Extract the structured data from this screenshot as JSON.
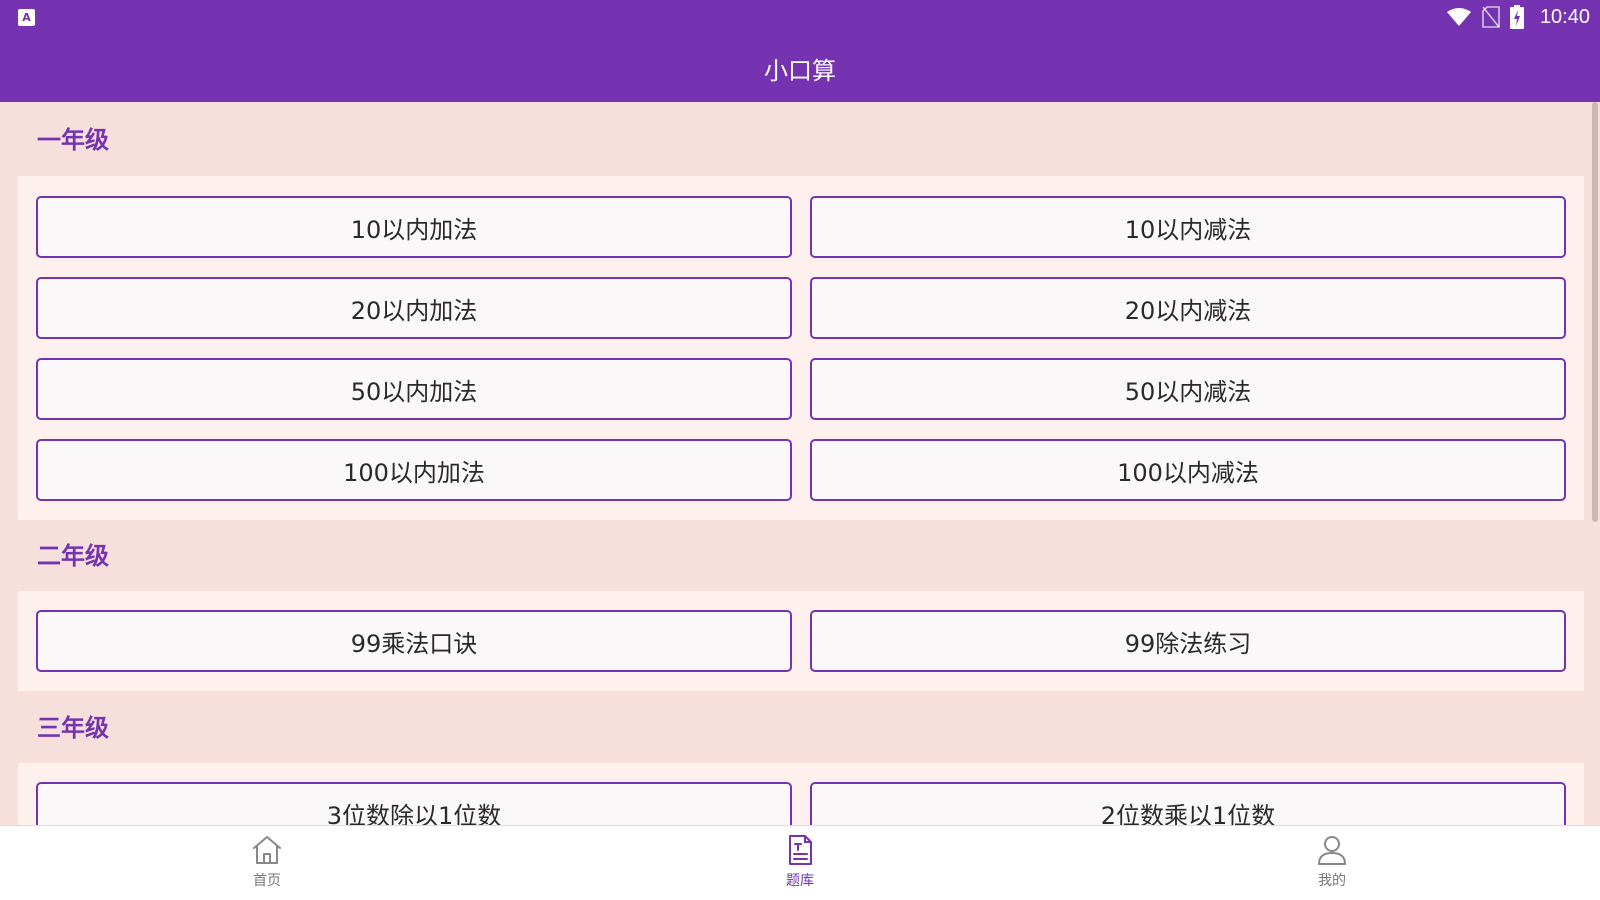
{
  "status_bar": {
    "time": "10:40",
    "app_icon_letter": "A"
  },
  "app_title": "小口算",
  "sections": [
    {
      "title": "一年级",
      "buttons": [
        "10以内加法",
        "10以内减法",
        "20以内加法",
        "20以内减法",
        "50以内加法",
        "50以内减法",
        "100以内加法",
        "100以内减法"
      ]
    },
    {
      "title": "二年级",
      "buttons": [
        "99乘法口诀",
        "99除法练习"
      ]
    },
    {
      "title": "三年级",
      "buttons": [
        "3位数除以1位数",
        "2位数乘以1位数"
      ]
    }
  ],
  "bottom_nav": [
    {
      "label": "首页",
      "icon": "home-icon",
      "active": false
    },
    {
      "label": "题库",
      "icon": "document-icon",
      "active": true
    },
    {
      "label": "我的",
      "icon": "person-icon",
      "active": false
    }
  ],
  "colors": {
    "primary": "#7633b1",
    "background": "#f7e0dc",
    "panel": "#fdf0ed",
    "button_bg": "#faf8f8"
  }
}
